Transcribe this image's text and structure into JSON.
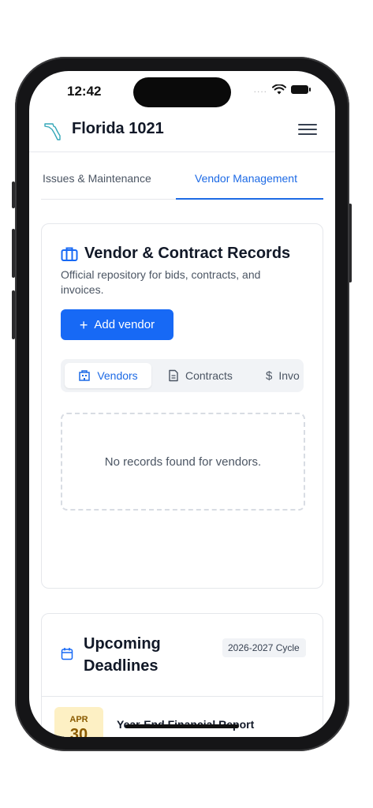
{
  "status_bar": {
    "time": "12:42",
    "signal": "....",
    "wifi_icon": "wifi-icon",
    "battery_icon": "battery-icon"
  },
  "app": {
    "title": "Florida 1021",
    "logo_icon": "florida-state-outline-icon",
    "menu_icon": "hamburger-menu-icon"
  },
  "tabs": [
    {
      "label": "Issues & Maintenance",
      "active": false
    },
    {
      "label": "Vendor Management",
      "active": true
    }
  ],
  "vendor_card": {
    "icon": "briefcase-icon",
    "title": "Vendor & Contract Records",
    "description": "Official repository for bids, contracts, and invoices.",
    "add_button": {
      "icon": "plus-icon",
      "label": "+",
      "text": "Add vendor"
    },
    "subtabs": [
      {
        "icon": "building-icon",
        "label": "Vendors",
        "active": true
      },
      {
        "icon": "document-icon",
        "label": "Contracts",
        "active": false
      },
      {
        "icon": "dollar-icon",
        "label": "Invo",
        "glyph": "$",
        "active": false
      }
    ],
    "empty_message": "No records found for vendors."
  },
  "deadlines_card": {
    "icon": "calendar-icon",
    "title": "Upcoming Deadlines",
    "cycle_badge": "2026-2027 Cycle",
    "items": [
      {
        "month": "APR",
        "day": "30",
        "title": "Year-End Financial Report"
      }
    ]
  },
  "colors": {
    "accent": "#1769f5",
    "text": "#111827",
    "muted": "#4b5563",
    "border": "#e5e7eb",
    "date_chip_bg": "#fdf0c4",
    "date_chip_text": "#8a5a00"
  }
}
